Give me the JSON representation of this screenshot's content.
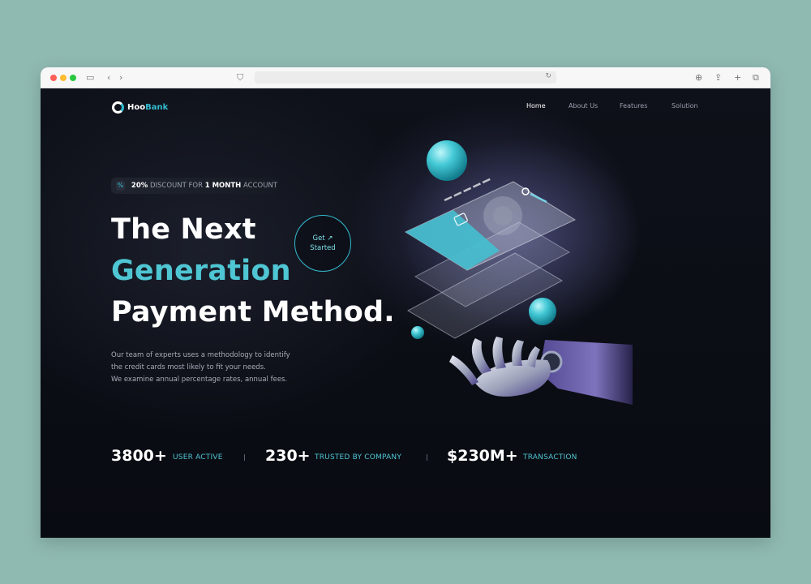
{
  "brand": {
    "logo_main": "Hoo",
    "logo_accent": "Bank",
    "accent_color": "#33bbcf",
    "background_color": "#0b0e17"
  },
  "nav": {
    "items": [
      {
        "label": "Home",
        "active": true
      },
      {
        "label": "About Us",
        "active": false
      },
      {
        "label": "Features",
        "active": false
      },
      {
        "label": "Solution",
        "active": false
      }
    ]
  },
  "hero": {
    "badge": {
      "icon": "discount-icon",
      "discount": "20%",
      "middle": " DISCOUNT FOR ",
      "duration": "1 MONTH",
      "suffix": " ACCOUNT"
    },
    "title_line1": "The Next",
    "title_line2": "Generation",
    "title_line3": "Payment Method.",
    "cta_line1": "Get",
    "cta_line2": "Started",
    "description": [
      "Our team of experts uses a methodology to identify",
      "the credit cards most likely to fit your needs.",
      "We examine annual percentage rates, annual fees."
    ]
  },
  "stats": [
    {
      "value": "3800+",
      "label": "USER ACTIVE"
    },
    {
      "value": "230+",
      "label": "TRUSTED BY COMPANY"
    },
    {
      "value": "$230M+",
      "label": "TRANSACTION"
    }
  ],
  "browser": {
    "icons": [
      "sidebar-icon",
      "back-icon",
      "forward-icon",
      "shield-icon",
      "reload-icon",
      "download-icon",
      "share-icon",
      "new-tab-icon",
      "tabs-icon"
    ]
  }
}
